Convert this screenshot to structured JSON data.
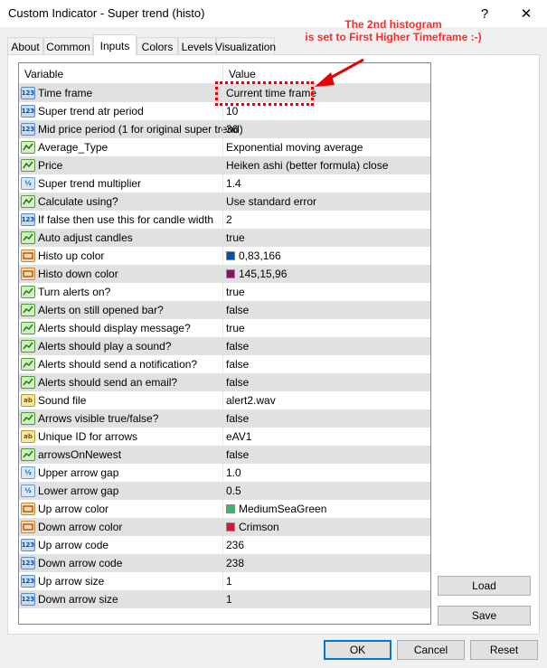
{
  "window": {
    "title": "Custom Indicator - Super trend (histo)",
    "help_glyph": "?",
    "close_glyph": "✕"
  },
  "annotation": {
    "line1": "The 2nd histogram",
    "line2": "is set to First Higher Timeframe :-)",
    "color": "#ff2a2a"
  },
  "tabs": [
    "About",
    "Common",
    "Inputs",
    "Colors",
    "Levels",
    "Visualization"
  ],
  "active_tab": "Inputs",
  "grid": {
    "header_variable": "Variable",
    "header_value": "Value",
    "rows": [
      {
        "icon": "int",
        "icon_text": "123",
        "variable": "Time frame",
        "value": "Current time frame"
      },
      {
        "icon": "int",
        "icon_text": "123",
        "variable": "Super trend atr period",
        "value": "10"
      },
      {
        "icon": "int",
        "icon_text": "123",
        "variable": "Mid price period (1 for original super trend)",
        "value": "36"
      },
      {
        "icon": "enum",
        "icon_text": "",
        "variable": "Average_Type",
        "value": "Exponential moving average"
      },
      {
        "icon": "enum",
        "icon_text": "",
        "variable": "Price",
        "value": "Heiken ashi (better formula) close"
      },
      {
        "icon": "dbl",
        "icon_text": "½",
        "variable": "Super trend multiplier",
        "value": "1.4"
      },
      {
        "icon": "enum",
        "icon_text": "",
        "variable": "Calculate using?",
        "value": "Use standard error"
      },
      {
        "icon": "int",
        "icon_text": "123",
        "variable": "If  false then use this for candle width",
        "value": "2"
      },
      {
        "icon": "bool",
        "icon_text": "",
        "variable": "Auto adjust candles",
        "value": "true"
      },
      {
        "icon": "color",
        "icon_text": "",
        "variable": "Histo up color",
        "value": "0,83,166",
        "swatch": "#0053a6"
      },
      {
        "icon": "color",
        "icon_text": "",
        "variable": "Histo down color",
        "value": "145,15,96",
        "swatch": "#910f60"
      },
      {
        "icon": "bool",
        "icon_text": "",
        "variable": "Turn alerts on?",
        "value": "true"
      },
      {
        "icon": "bool",
        "icon_text": "",
        "variable": "Alerts on still opened bar?",
        "value": "false"
      },
      {
        "icon": "bool",
        "icon_text": "",
        "variable": "Alerts should display message?",
        "value": "true"
      },
      {
        "icon": "bool",
        "icon_text": "",
        "variable": "Alerts should play a sound?",
        "value": "false"
      },
      {
        "icon": "bool",
        "icon_text": "",
        "variable": "Alerts should send a notification?",
        "value": "false"
      },
      {
        "icon": "bool",
        "icon_text": "",
        "variable": "Alerts should send an email?",
        "value": "false"
      },
      {
        "icon": "str",
        "icon_text": "ab",
        "variable": "Sound file",
        "value": "alert2.wav"
      },
      {
        "icon": "bool",
        "icon_text": "",
        "variable": "Arrows visible true/false?",
        "value": "false"
      },
      {
        "icon": "str",
        "icon_text": "ab",
        "variable": "Unique ID for arrows",
        "value": "eAV1"
      },
      {
        "icon": "bool",
        "icon_text": "",
        "variable": "arrowsOnNewest",
        "value": "false"
      },
      {
        "icon": "dbl",
        "icon_text": "½",
        "variable": "Upper arrow gap",
        "value": "1.0"
      },
      {
        "icon": "dbl",
        "icon_text": "½",
        "variable": "Lower arrow gap",
        "value": "0.5"
      },
      {
        "icon": "color",
        "icon_text": "",
        "variable": "Up arrow color",
        "value": "MediumSeaGreen",
        "swatch": "#3cb371"
      },
      {
        "icon": "color",
        "icon_text": "",
        "variable": "Down arrow color",
        "value": "Crimson",
        "swatch": "#dc143c"
      },
      {
        "icon": "int",
        "icon_text": "123",
        "variable": "Up arrow code",
        "value": "236"
      },
      {
        "icon": "int",
        "icon_text": "123",
        "variable": "Down arrow code",
        "value": "238"
      },
      {
        "icon": "int",
        "icon_text": "123",
        "variable": "Up arrow size",
        "value": "1"
      },
      {
        "icon": "int",
        "icon_text": "123",
        "variable": "Down arrow size",
        "value": "1"
      }
    ]
  },
  "side_buttons": {
    "load": "Load",
    "save": "Save"
  },
  "footer_buttons": {
    "ok": "OK",
    "cancel": "Cancel",
    "reset": "Reset"
  }
}
